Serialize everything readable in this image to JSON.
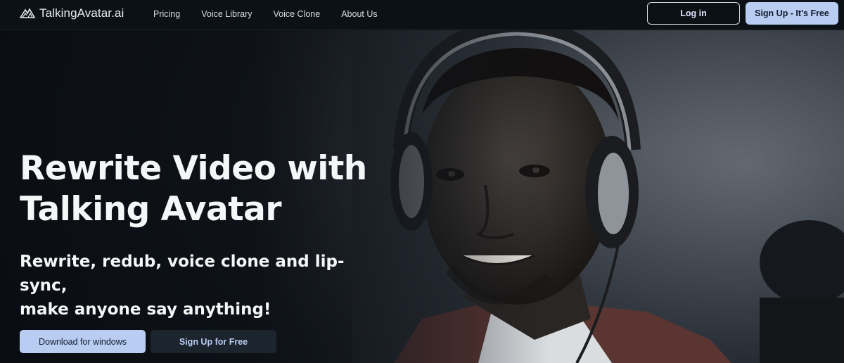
{
  "nav": {
    "brand": "TalkingAvatar.ai",
    "links": [
      {
        "label": "Pricing"
      },
      {
        "label": "Voice Library"
      },
      {
        "label": "Voice Clone"
      },
      {
        "label": "About Us"
      }
    ],
    "login_label": "Log in",
    "signup_label": "Sign Up - It's Free"
  },
  "hero": {
    "headline_line1": "Rewrite Video with",
    "headline_line2": "Talking Avatar",
    "subline_line1": "Rewrite, redub, voice clone and lip-sync,",
    "subline_line2": "make anyone say anything!",
    "download_label": "Download for windows",
    "free_label": "Sign Up for Free",
    "image_subject": "man-with-headphones-photo"
  },
  "colors": {
    "accent": "#b9cdf3",
    "nav_bg": "#0c1116",
    "hero_dark": "#0e1318"
  }
}
